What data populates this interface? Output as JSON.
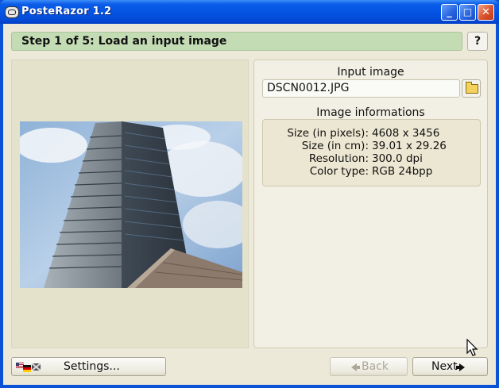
{
  "window": {
    "title": "PosteRazor 1.2",
    "controls": {
      "minimize": "_",
      "maximize": "□",
      "close": "✕"
    }
  },
  "step": {
    "label": "Step 1 of 5: Load an input image",
    "help": "?"
  },
  "input_image": {
    "section_title": "Input image",
    "filename": "DSCN0012.JPG"
  },
  "image_info": {
    "section_title": "Image informations",
    "rows": [
      {
        "key": "Size (in pixels):",
        "value": "4608 x 3456"
      },
      {
        "key": "Size (in cm):",
        "value": "39.01 x 29.26"
      },
      {
        "key": "Resolution:",
        "value": "300.0 dpi"
      },
      {
        "key": "Color type:",
        "value": "RGB 24bpp"
      }
    ]
  },
  "footer": {
    "settings_label": "Settings...",
    "back_label": "Back",
    "next_label": "Next",
    "back_enabled": false
  },
  "colors": {
    "title_bar": "#0554e3",
    "step_bar": "#c4dcb4",
    "window_bg": "#ece9d8",
    "preview_bg": "#e5e2cc",
    "close_button": "#d9532d"
  },
  "icons": [
    "app-icon",
    "help-icon",
    "folder-icon",
    "flags-icon",
    "arrow-left-icon",
    "arrow-right-icon",
    "cursor-icon"
  ]
}
